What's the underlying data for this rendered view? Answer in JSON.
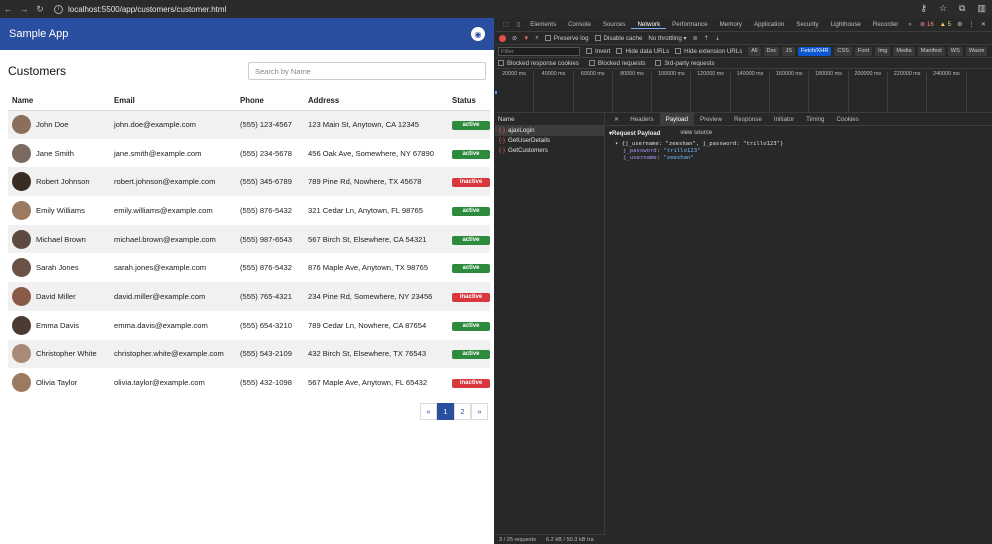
{
  "browser": {
    "url": "localhost:5500/app/customers/customer.html"
  },
  "app": {
    "brand": "Sample App",
    "page_title": "Customers",
    "search_placeholder": "Search by Name",
    "columns": [
      "Name",
      "Email",
      "Phone",
      "Address",
      "Status"
    ],
    "customers": [
      {
        "name": "John Doe",
        "email": "john.doe@example.com",
        "phone": "(555) 123-4567",
        "address": "123 Main St, Anytown, CA 12345",
        "status": "active"
      },
      {
        "name": "Jane Smith",
        "email": "jane.smith@example.com",
        "phone": "(555) 234-5678",
        "address": "456 Oak Ave, Somewhere, NY 67890",
        "status": "active"
      },
      {
        "name": "Robert Johnson",
        "email": "robert.johnson@example.com",
        "phone": "(555) 345-6789",
        "address": "789 Pine Rd, Nowhere, TX 45678",
        "status": "inactive"
      },
      {
        "name": "Emily Williams",
        "email": "emily.williams@example.com",
        "phone": "(555) 876-5432",
        "address": "321 Cedar Ln, Anytown, FL 98765",
        "status": "active"
      },
      {
        "name": "Michael Brown",
        "email": "michael.brown@example.com",
        "phone": "(555) 987-6543",
        "address": "567 Birch St, Elsewhere, CA 54321",
        "status": "active"
      },
      {
        "name": "Sarah Jones",
        "email": "sarah.jones@example.com",
        "phone": "(555) 876-5432",
        "address": "876 Maple Ave, Anytown, TX 98765",
        "status": "active"
      },
      {
        "name": "David Miller",
        "email": "david.miller@example.com",
        "phone": "(555) 765-4321",
        "address": "234 Pine Rd, Somewhere, NY 23456",
        "status": "inactive"
      },
      {
        "name": "Emma Davis",
        "email": "emma.davis@example.com",
        "phone": "(555) 654-3210",
        "address": "789 Cedar Ln, Nowhere, CA 87654",
        "status": "active"
      },
      {
        "name": "Christopher White",
        "email": "christopher.white@example.com",
        "phone": "(555) 543-2109",
        "address": "432 Birch St, Elsewhere, TX 76543",
        "status": "active"
      },
      {
        "name": "Olivia Taylor",
        "email": "olivia.taylor@example.com",
        "phone": "(555) 432-1098",
        "address": "567 Maple Ave, Anytown, FL 65432",
        "status": "inactive"
      }
    ],
    "pagination": {
      "prev": "«",
      "pages": [
        "1",
        "2"
      ],
      "current": "1",
      "next": "»"
    },
    "colors": {
      "primary": "#2b4fa0",
      "active": "#2e8b3e",
      "inactive": "#d9363e"
    }
  },
  "devtools": {
    "tabs": [
      "Elements",
      "Console",
      "Sources",
      "Network",
      "Performance",
      "Memory",
      "Application",
      "Security",
      "Lighthouse",
      "Recorder"
    ],
    "selected_tab": "Network",
    "error_count": "16",
    "warning_count": "5",
    "toolbar": {
      "preserve_log": "Preserve log",
      "disable_cache": "Disable cache",
      "throttling": "No throttling"
    },
    "filter": {
      "placeholder": "Filter",
      "invert": "Invert",
      "hide_data_urls": "Hide data URLs",
      "hide_extension_urls": "Hide extension URLs",
      "types": [
        "All",
        "Doc",
        "JS",
        "Fetch/XHR",
        "CSS",
        "Font",
        "Img",
        "Media",
        "Manifest",
        "WS",
        "Wasm"
      ],
      "selected_type": "Fetch/XHR"
    },
    "blocked": {
      "response_cookies": "Blocked response cookies",
      "requests": "Blocked requests",
      "third_party": "3rd-party requests"
    },
    "timeline_ticks": [
      "20000 ms",
      "40000 ms",
      "60000 ms",
      "80000 ms",
      "100000 ms",
      "120000 ms",
      "140000 ms",
      "160000 ms",
      "180000 ms",
      "200000 ms",
      "220000 ms",
      "240000 ms"
    ],
    "name_header": "Name",
    "requests": [
      "ajaxLogin",
      "GetUserDetails",
      "GetCustomers"
    ],
    "detail_tabs": [
      "Headers",
      "Payload",
      "Preview",
      "Response",
      "Initiator",
      "Timing",
      "Cookies"
    ],
    "selected_detail_tab": "Payload",
    "payload": {
      "title": "Request Payload",
      "view_source": "view source",
      "summary": "{j_username: \"zeeshan\", j_password: \"trillo123\"}",
      "fields": [
        {
          "key": "j_password",
          "value": "\"trillo123\""
        },
        {
          "key": "j_username",
          "value": "\"zeeshan\""
        }
      ]
    },
    "status": {
      "requests": "3 / 25 requests",
      "transferred": "6.2 kB / 50.3 kB tra"
    }
  }
}
